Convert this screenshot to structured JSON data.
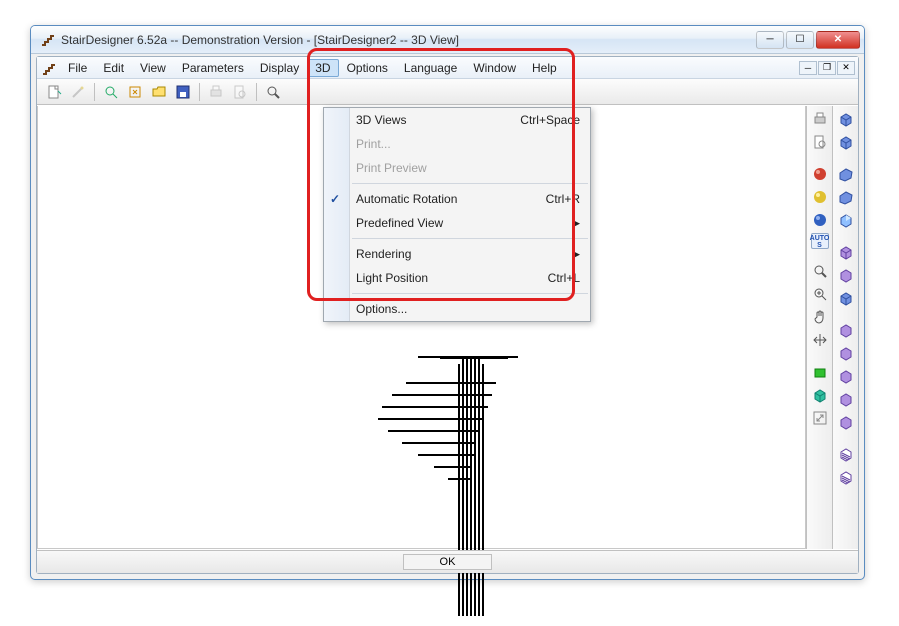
{
  "outer_title": "StairDesigner 6.52a -- Demonstration Version - [StairDesigner2 -- 3D View]",
  "menubar": {
    "items": [
      "File",
      "Edit",
      "View",
      "Parameters",
      "Display",
      "3D",
      "Options",
      "Language",
      "Window",
      "Help"
    ]
  },
  "dropdown": {
    "items": [
      {
        "label": "3D Views",
        "shortcut": "Ctrl+Space",
        "enabled": true
      },
      {
        "label": "Print...",
        "enabled": false
      },
      {
        "label": "Print Preview",
        "enabled": false
      },
      {
        "sep": true
      },
      {
        "label": "Automatic Rotation",
        "shortcut": "Ctrl+R",
        "enabled": true,
        "checked": true
      },
      {
        "label": "Predefined View",
        "submenu": true,
        "enabled": true
      },
      {
        "sep": true
      },
      {
        "label": "Rendering",
        "submenu": true,
        "enabled": true
      },
      {
        "label": "Light Position",
        "shortcut": "Ctrl+L",
        "enabled": true
      },
      {
        "sep": true
      },
      {
        "label": "Options...",
        "enabled": true
      }
    ]
  },
  "toolbar_left": [
    "new-doc-icon",
    "wand-icon",
    "zoom-reset-icon",
    "recalc-icon",
    "open-icon",
    "save-icon",
    "print-icon",
    "preview-icon",
    "zoom-icon"
  ],
  "right_col_a": [
    "print-icon",
    "doc-icon",
    "zoom-icon",
    "sphere-red-icon",
    "sphere-yellow-icon",
    "sphere-blue-icon",
    "autos-icon",
    "search-icon",
    "zoom-in-icon",
    "hand-icon",
    "pan-icon",
    "box-green-icon",
    "box-teal-icon",
    "resize-icon"
  ],
  "right_col_b": [
    "cube-blue-icon",
    "cube-blue-icon",
    "cube-skew-icon",
    "cube-skew-icon",
    "cube-hi-icon",
    "cube-purple-icon",
    "cube-purple-icon",
    "cube-blue-icon",
    "cube-purple-icon",
    "cube-purple-icon",
    "cube-purple-icon",
    "cube-purple-icon",
    "cube-purple-icon",
    "hatch-cube-icon",
    "hatch-cube-icon"
  ],
  "statusbar": {
    "ok": "OK"
  }
}
